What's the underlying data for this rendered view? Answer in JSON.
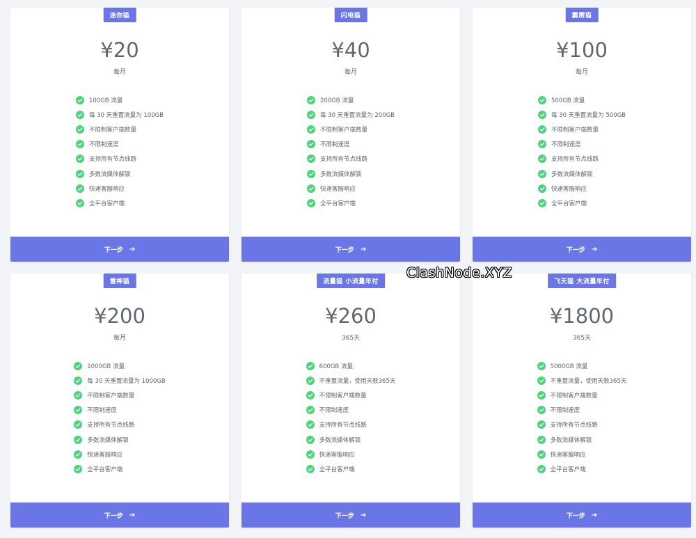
{
  "plans": [
    {
      "badge": "迷你猫",
      "price": "¥20",
      "period": "每月",
      "features": [
        "100GB 流量",
        "每 30 天重置流量为 100GB",
        "不限制客户端数量",
        "不限制速度",
        "支持所有节点线路",
        "多数流媒体解锁",
        "快速客服响应",
        "全平台客户端"
      ],
      "button": "下一步"
    },
    {
      "badge": "闪电猫",
      "price": "¥40",
      "period": "每月",
      "features": [
        "200GB 流量",
        "每 30 天重置流量为 200GB",
        "不限制客户端数量",
        "不限制速度",
        "支持所有节点线路",
        "多数流媒体解锁",
        "快速客服响应",
        "全平台客户端"
      ],
      "button": "下一步"
    },
    {
      "badge": "霹雳猫",
      "price": "¥100",
      "period": "每月",
      "features": [
        "500GB 流量",
        "每 30 天重置流量为 500GB",
        "不限制客户端数量",
        "不限制速度",
        "支持所有节点线路",
        "多数流媒体解锁",
        "快速客服响应",
        "全平台客户端"
      ],
      "button": "下一步"
    },
    {
      "badge": "雷神猫",
      "price": "¥200",
      "period": "每月",
      "features": [
        "1000GB 流量",
        "每 30 天重置流量为 1000GB",
        "不限制客户端数量",
        "不限制速度",
        "支持所有节点线路",
        "多数流媒体解锁",
        "快速客服响应",
        "全平台客户端"
      ],
      "button": "下一步"
    },
    {
      "badge": "流量猫 小流量年付",
      "price": "¥260",
      "period": "365天",
      "features": [
        "600GB 流量",
        "不重置流量，使用天数365天",
        "不限制客户端数量",
        "不限制速度",
        "支持所有节点线路",
        "多数流媒体解锁",
        "快速客服响应",
        "全平台客户端"
      ],
      "button": "下一步"
    },
    {
      "badge": "飞天猫 大流量年付",
      "price": "¥1800",
      "period": "365天",
      "features": [
        "5000GB 流量",
        "不重置流量，使用天数365天",
        "不限制客户端数量",
        "不限制速度",
        "支持所有节点线路",
        "多数流媒体解锁",
        "快速客服响应",
        "全平台客户端"
      ],
      "button": "下一步"
    }
  ],
  "watermark": "ClashNode.XYZ",
  "icons": {
    "feature": "check-circle-icon",
    "button": "arrow-right-icon"
  },
  "colors": {
    "accent": "#6b76e6",
    "check": "#4bd47a",
    "text": "#62676e",
    "background": "#f2f4f8"
  }
}
